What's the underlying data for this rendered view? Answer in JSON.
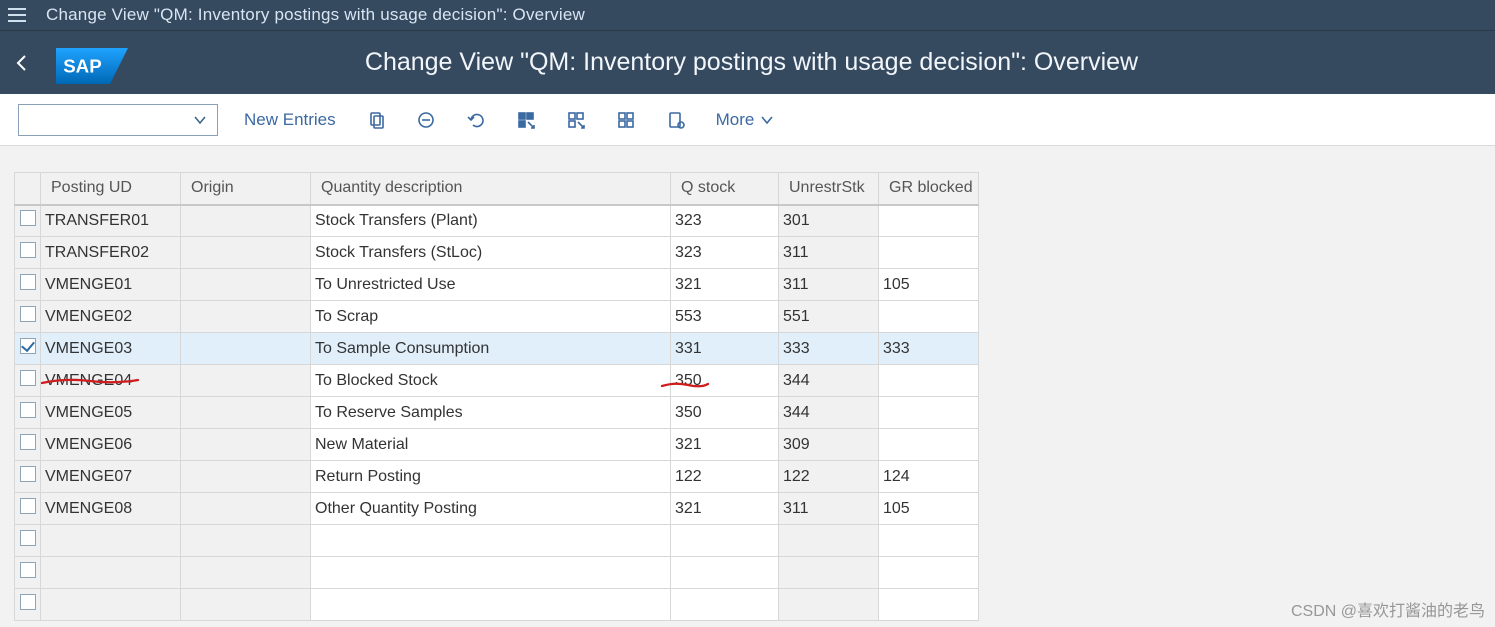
{
  "sysbar": {
    "title": "Change View \"QM: Inventory postings with usage decision\": Overview"
  },
  "header": {
    "title": "Change View \"QM: Inventory postings with usage decision\": Overview",
    "logo_text": "SAP"
  },
  "toolbar": {
    "select_value": "",
    "new_entries_label": "New Entries",
    "more_label": "More",
    "icons": {
      "copy": "copy-icon",
      "delete": "delete-icon",
      "undo": "undo-icon",
      "select_all": "select-all-icon",
      "select_block": "select-block-icon",
      "deselect_all": "deselect-all-icon",
      "config": "config-icon"
    }
  },
  "table": {
    "columns": {
      "select": "",
      "posting_ud": "Posting UD",
      "origin": "Origin",
      "qty_desc": "Quantity description",
      "q_stock": "Q stock",
      "unrestr": "UnrestrStk",
      "gr_blocked": "GR blocked"
    },
    "rows": [
      {
        "selected": false,
        "posting_ud": "TRANSFER01",
        "origin": "",
        "qty_desc": "Stock Transfers (Plant)",
        "q_stock": "323",
        "unrestr": "301",
        "gr_blocked": ""
      },
      {
        "selected": false,
        "posting_ud": "TRANSFER02",
        "origin": "",
        "qty_desc": "Stock Transfers (StLoc)",
        "q_stock": "323",
        "unrestr": "311",
        "gr_blocked": ""
      },
      {
        "selected": false,
        "posting_ud": "VMENGE01",
        "origin": "",
        "qty_desc": "To Unrestricted Use",
        "q_stock": "321",
        "unrestr": "311",
        "gr_blocked": "105"
      },
      {
        "selected": false,
        "posting_ud": "VMENGE02",
        "origin": "",
        "qty_desc": "To Scrap",
        "q_stock": "553",
        "unrestr": "551",
        "gr_blocked": ""
      },
      {
        "selected": true,
        "posting_ud": "VMENGE03",
        "origin": "",
        "qty_desc": "To Sample Consumption",
        "q_stock": "331",
        "unrestr": "333",
        "gr_blocked": "333"
      },
      {
        "selected": false,
        "posting_ud": "VMENGE04",
        "origin": "",
        "qty_desc": "To Blocked Stock",
        "q_stock": "350",
        "unrestr": "344",
        "gr_blocked": ""
      },
      {
        "selected": false,
        "posting_ud": "VMENGE05",
        "origin": "",
        "qty_desc": "To Reserve Samples",
        "q_stock": "350",
        "unrestr": "344",
        "gr_blocked": ""
      },
      {
        "selected": false,
        "posting_ud": "VMENGE06",
        "origin": "",
        "qty_desc": "New Material",
        "q_stock": "321",
        "unrestr": "309",
        "gr_blocked": ""
      },
      {
        "selected": false,
        "posting_ud": "VMENGE07",
        "origin": "",
        "qty_desc": "Return Posting",
        "q_stock": "122",
        "unrestr": "122",
        "gr_blocked": "124"
      },
      {
        "selected": false,
        "posting_ud": "VMENGE08",
        "origin": "",
        "qty_desc": "Other Quantity Posting",
        "q_stock": "321",
        "unrestr": "311",
        "gr_blocked": "105"
      }
    ],
    "blank_rows": 3
  },
  "watermark": "CSDN @喜欢打酱油的老鸟"
}
